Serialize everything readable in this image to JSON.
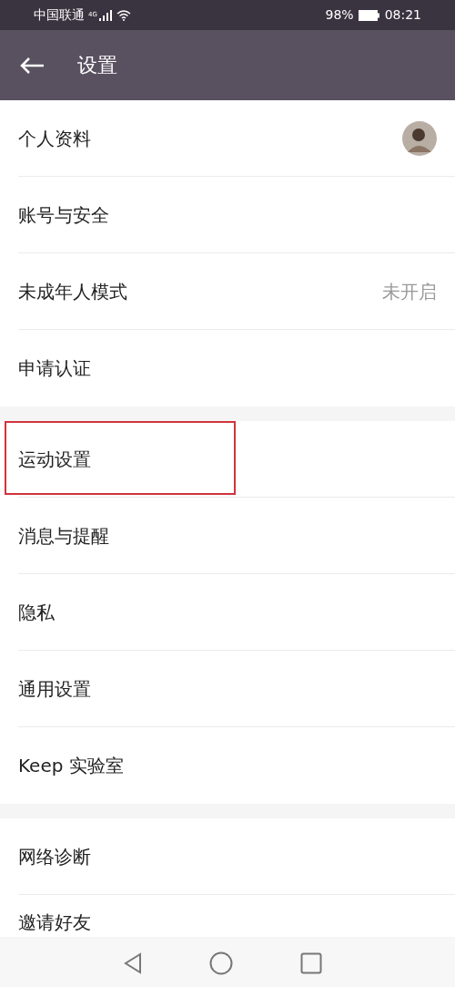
{
  "status_bar": {
    "carrier": "中国联通",
    "network": "4G",
    "battery": "98%",
    "time": "08:21"
  },
  "header": {
    "title": "设置"
  },
  "groups": [
    {
      "items": [
        {
          "label": "个人资料",
          "kind": "avatar",
          "highlighted": false
        },
        {
          "label": "账号与安全",
          "kind": "plain",
          "highlighted": false
        },
        {
          "label": "未成年人模式",
          "kind": "value",
          "value": "未开启",
          "highlighted": false
        },
        {
          "label": "申请认证",
          "kind": "plain",
          "highlighted": false
        }
      ]
    },
    {
      "items": [
        {
          "label": "运动设置",
          "kind": "plain",
          "highlighted": true
        },
        {
          "label": "消息与提醒",
          "kind": "plain",
          "highlighted": false
        },
        {
          "label": "隐私",
          "kind": "plain",
          "highlighted": false
        },
        {
          "label": "通用设置",
          "kind": "plain",
          "highlighted": false
        },
        {
          "label": "Keep 实验室",
          "kind": "plain",
          "highlighted": false
        }
      ]
    },
    {
      "items": [
        {
          "label": "网络诊断",
          "kind": "plain",
          "highlighted": false
        },
        {
          "label": "邀请好友",
          "kind": "plain",
          "highlighted": false
        }
      ]
    }
  ]
}
